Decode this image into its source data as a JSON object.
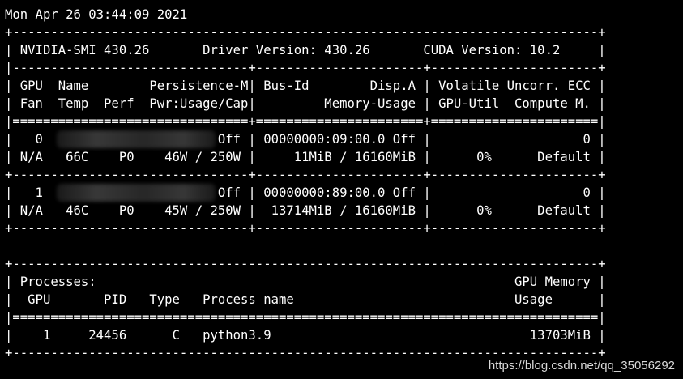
{
  "terminal": {
    "lines": [
      "Mon Apr 26 03:44:09 2021",
      "+-----------------------------------------------------------------------------+",
      "| NVIDIA-SMI 430.26       Driver Version: 430.26       CUDA Version: 10.2     |",
      "|-------------------------------+----------------------+----------------------+",
      "| GPU  Name        Persistence-M| Bus-Id        Disp.A | Volatile Uncorr. ECC |",
      "| Fan  Temp  Perf  Pwr:Usage/Cap|         Memory-Usage | GPU-Util  Compute M. |",
      "|===============================+======================+======================|",
      "|   0                       Off | 00000000:09:00.0 Off |                    0 |",
      "| N/A   66C    P0    46W / 250W |     11MiB / 16160MiB |      0%      Default |",
      "+-------------------------------+----------------------+----------------------+",
      "|   1                       Off | 00000000:89:00.0 Off |                    0 |",
      "| N/A   46C    P0    45W / 250W |  13714MiB / 16160MiB |      0%      Default |",
      "+-------------------------------+----------------------+----------------------+",
      "",
      "+-----------------------------------------------------------------------------+",
      "| Processes:                                                       GPU Memory |",
      "|  GPU       PID   Type   Process name                             Usage      |",
      "|=============================================================================|",
      "|    1     24456      C   python3.9                                  13703MiB |",
      "+-----------------------------------------------------------------------------+"
    ]
  },
  "watermark": "https://blog.csdn.net/qq_35056292"
}
